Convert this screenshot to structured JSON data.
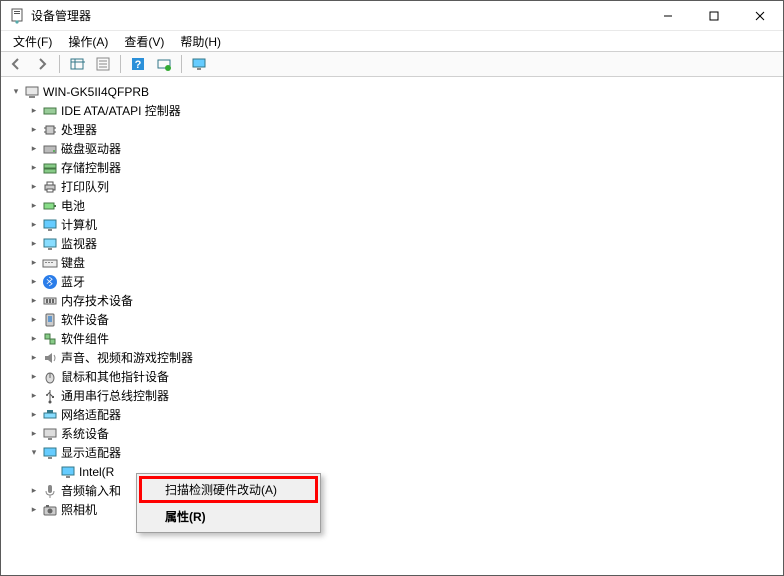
{
  "window": {
    "title": "设备管理器",
    "controls": {
      "minimize": "—",
      "maximize": "☐",
      "close": "✕"
    }
  },
  "menubar": {
    "file": "文件(F)",
    "action": "操作(A)",
    "view": "查看(V)",
    "help": "帮助(H)"
  },
  "tree": {
    "root": "WIN-GK5II4QFPRB",
    "nodes": {
      "n0": "IDE ATA/ATAPI 控制器",
      "n1": "处理器",
      "n2": "磁盘驱动器",
      "n3": "存储控制器",
      "n4": "打印队列",
      "n5": "电池",
      "n6": "计算机",
      "n7": "监视器",
      "n8": "键盘",
      "n9": "蓝牙",
      "n10": "内存技术设备",
      "n11": "软件设备",
      "n12": "软件组件",
      "n13": "声音、视频和游戏控制器",
      "n14": "鼠标和其他指针设备",
      "n15": "通用串行总线控制器",
      "n16": "网络适配器",
      "n17": "系统设备",
      "n18": "显示适配器",
      "n18c0": "Intel(R",
      "n19": "音频输入和",
      "n20": "照相机"
    }
  },
  "context_menu": {
    "scan": "扫描检测硬件改动(A)",
    "properties": "属性(R)"
  }
}
